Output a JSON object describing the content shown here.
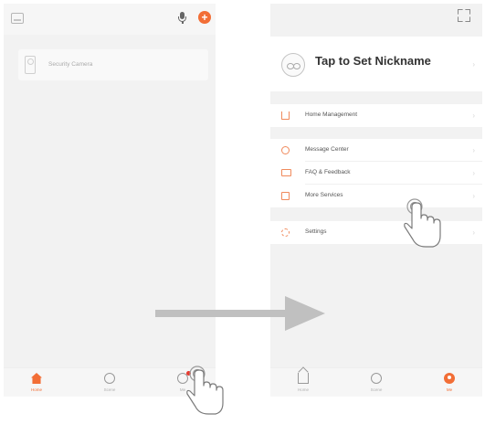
{
  "left_screen": {
    "device_card": {
      "name": "Security Camera",
      "icon": "camera-icon"
    },
    "header_icons": [
      "home-icon",
      "mic-icon",
      "add-icon"
    ],
    "tabs": [
      {
        "label": "Home",
        "icon": "home-icon",
        "active": true
      },
      {
        "label": "Scene",
        "icon": "scene-icon",
        "active": false
      },
      {
        "label": "Me",
        "icon": "me-icon",
        "active": false,
        "badge": true
      }
    ]
  },
  "right_screen": {
    "nickname": "Tap to Set Nickname",
    "menu": [
      {
        "label": "Home Management",
        "icon": "home-icon"
      },
      {
        "label": "Message Center",
        "icon": "message-icon"
      },
      {
        "label": "FAQ & Feedback",
        "icon": "faq-icon"
      },
      {
        "label": "More Services",
        "icon": "services-icon"
      },
      {
        "label": "Settings",
        "icon": "settings-icon"
      }
    ],
    "chevron": "›",
    "tabs": [
      {
        "label": "Home",
        "icon": "home-icon",
        "active": false
      },
      {
        "label": "Scene",
        "icon": "scene-icon",
        "active": false
      },
      {
        "label": "Me",
        "icon": "me-icon",
        "active": true
      }
    ]
  },
  "colors": {
    "accent": "#f26e36",
    "arrow": "#c0c0c0",
    "background": "#f2f2f2"
  }
}
